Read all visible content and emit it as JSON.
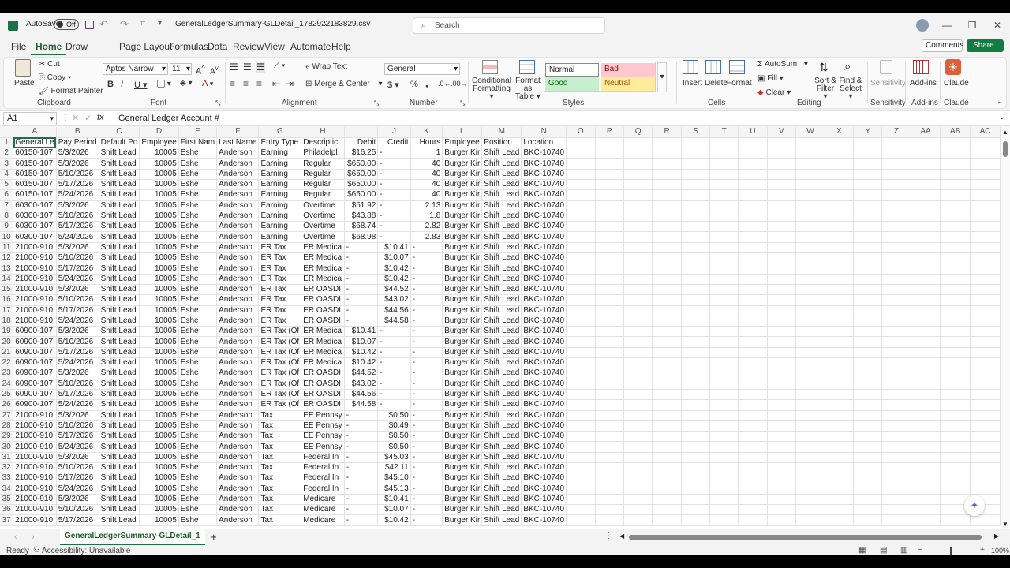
{
  "title": {
    "autosave_label": "AutoSave",
    "autosave_state": "Off",
    "filename": "GeneralLedgerSummary-GLDetail_1782922183829.csv",
    "search_placeholder": "Search"
  },
  "menu": [
    "File",
    "Home",
    "Draw",
    "Page Layout",
    "Formulas",
    "Data",
    "Review",
    "View",
    "Automate",
    "Help"
  ],
  "menu_active": "Home",
  "comments_label": "Comments",
  "share_label": "Share",
  "ribbon": {
    "clipboard": {
      "paste": "Paste",
      "cut": "Cut",
      "copy": "Copy",
      "format_painter": "Format Painter",
      "group": "Clipboard"
    },
    "font": {
      "name": "Aptos Narrow",
      "size": "11",
      "group": "Font"
    },
    "alignment": {
      "wrap": "Wrap Text",
      "merge": "Merge & Center",
      "group": "Alignment"
    },
    "number": {
      "format": "General",
      "group": "Number"
    },
    "styles": {
      "conditional": "Conditional Formatting",
      "format_table": "Format as Table",
      "normal": "Normal",
      "bad": "Bad",
      "good": "Good",
      "neutral": "Neutral",
      "group": "Styles"
    },
    "cells": {
      "insert": "Insert",
      "delete": "Delete",
      "format": "Format",
      "group": "Cells"
    },
    "editing": {
      "autosum": "AutoSum",
      "fill": "Fill",
      "clear": "Clear",
      "sort": "Sort & Filter",
      "find": "Find & Select",
      "group": "Editing"
    },
    "sensitivity": {
      "label": "Sensitivity",
      "group": "Sensitivity"
    },
    "addins": {
      "label": "Add-ins",
      "group": "Add-ins"
    },
    "claude": {
      "label": "Claude",
      "group": "Claude"
    }
  },
  "formula": {
    "cell_ref": "A1",
    "fx": "fx",
    "content": "General Ledger Account #"
  },
  "columns": [
    "A",
    "B",
    "C",
    "D",
    "E",
    "F",
    "G",
    "H",
    "I",
    "J",
    "K",
    "L",
    "M",
    "N",
    "O",
    "P",
    "Q",
    "R",
    "S",
    "T",
    "U",
    "V",
    "W",
    "X",
    "Y",
    "Z",
    "AA",
    "AB",
    "AC"
  ],
  "header_row": [
    "General Le",
    "Pay Period",
    "Default Po",
    "Employee",
    "First Nam",
    "Last Name",
    "Entry Type",
    "Descriptic",
    "Debit",
    "Credit",
    "Hours",
    "Employee",
    "Position",
    "Location"
  ],
  "rows": [
    [
      "60150-107",
      "5/3/2026",
      "Shift Lead",
      "10005",
      "Eshe",
      "Anderson",
      "Earning",
      "Philadelpl",
      "$16.25",
      "-",
      "1",
      "Burger Kir",
      "Shift Lead",
      "BKC-10740"
    ],
    [
      "60150-107",
      "5/3/2026",
      "Shift Lead",
      "10005",
      "Eshe",
      "Anderson",
      "Earning",
      "Regular",
      "$650.00",
      "-",
      "40",
      "Burger Kir",
      "Shift Lead",
      "BKC-10740"
    ],
    [
      "60150-107",
      "5/10/2026",
      "Shift Lead",
      "10005",
      "Eshe",
      "Anderson",
      "Earning",
      "Regular",
      "$650.00",
      "-",
      "40",
      "Burger Kir",
      "Shift Lead",
      "BKC-10740"
    ],
    [
      "60150-107",
      "5/17/2026",
      "Shift Lead",
      "10005",
      "Eshe",
      "Anderson",
      "Earning",
      "Regular",
      "$650.00",
      "-",
      "40",
      "Burger Kir",
      "Shift Lead",
      "BKC-10740"
    ],
    [
      "60150-107",
      "5/24/2026",
      "Shift Lead",
      "10005",
      "Eshe",
      "Anderson",
      "Earning",
      "Regular",
      "$650.00",
      "-",
      "40",
      "Burger Kir",
      "Shift Lead",
      "BKC-10740"
    ],
    [
      "60300-107",
      "5/3/2026",
      "Shift Lead",
      "10005",
      "Eshe",
      "Anderson",
      "Earning",
      "Overtime",
      "$51.92",
      "-",
      "2.13",
      "Burger Kir",
      "Shift Lead",
      "BKC-10740"
    ],
    [
      "60300-107",
      "5/10/2026",
      "Shift Lead",
      "10005",
      "Eshe",
      "Anderson",
      "Earning",
      "Overtime",
      "$43.88",
      "-",
      "1.8",
      "Burger Kir",
      "Shift Lead",
      "BKC-10740"
    ],
    [
      "60300-107",
      "5/17/2026",
      "Shift Lead",
      "10005",
      "Eshe",
      "Anderson",
      "Earning",
      "Overtime",
      "$68.74",
      "-",
      "2.82",
      "Burger Kir",
      "Shift Lead",
      "BKC-10740"
    ],
    [
      "60300-107",
      "5/24/2026",
      "Shift Lead",
      "10005",
      "Eshe",
      "Anderson",
      "Earning",
      "Overtime",
      "$68.98",
      "-",
      "2.83",
      "Burger Kir",
      "Shift Lead",
      "BKC-10740"
    ],
    [
      "21000-910",
      "5/3/2026",
      "Shift Lead",
      "10005",
      "Eshe",
      "Anderson",
      "ER Tax",
      "ER Medica",
      "-",
      "$10.41",
      "-",
      "Burger Kir",
      "Shift Lead",
      "BKC-10740"
    ],
    [
      "21000-910",
      "5/10/2026",
      "Shift Lead",
      "10005",
      "Eshe",
      "Anderson",
      "ER Tax",
      "ER Medica",
      "-",
      "$10.07",
      "-",
      "Burger Kir",
      "Shift Lead",
      "BKC-10740"
    ],
    [
      "21000-910",
      "5/17/2026",
      "Shift Lead",
      "10005",
      "Eshe",
      "Anderson",
      "ER Tax",
      "ER Medica",
      "-",
      "$10.42",
      "-",
      "Burger Kir",
      "Shift Lead",
      "BKC-10740"
    ],
    [
      "21000-910",
      "5/24/2026",
      "Shift Lead",
      "10005",
      "Eshe",
      "Anderson",
      "ER Tax",
      "ER Medica",
      "-",
      "$10.42",
      "-",
      "Burger Kir",
      "Shift Lead",
      "BKC-10740"
    ],
    [
      "21000-910",
      "5/3/2026",
      "Shift Lead",
      "10005",
      "Eshe",
      "Anderson",
      "ER Tax",
      "ER OASDI",
      "-",
      "$44.52",
      "-",
      "Burger Kir",
      "Shift Lead",
      "BKC-10740"
    ],
    [
      "21000-910",
      "5/10/2026",
      "Shift Lead",
      "10005",
      "Eshe",
      "Anderson",
      "ER Tax",
      "ER OASDI",
      "-",
      "$43.02",
      "-",
      "Burger Kir",
      "Shift Lead",
      "BKC-10740"
    ],
    [
      "21000-910",
      "5/17/2026",
      "Shift Lead",
      "10005",
      "Eshe",
      "Anderson",
      "ER Tax",
      "ER OASDI",
      "-",
      "$44.56",
      "-",
      "Burger Kir",
      "Shift Lead",
      "BKC-10740"
    ],
    [
      "21000-910",
      "5/24/2026",
      "Shift Lead",
      "10005",
      "Eshe",
      "Anderson",
      "ER Tax",
      "ER OASDI",
      "-",
      "$44.58",
      "-",
      "Burger Kir",
      "Shift Lead",
      "BKC-10740"
    ],
    [
      "60900-107",
      "5/3/2026",
      "Shift Lead",
      "10005",
      "Eshe",
      "Anderson",
      "ER Tax (Of",
      "ER Medica",
      "$10.41",
      "-",
      "-",
      "Burger Kir",
      "Shift Lead",
      "BKC-10740"
    ],
    [
      "60900-107",
      "5/10/2026",
      "Shift Lead",
      "10005",
      "Eshe",
      "Anderson",
      "ER Tax (Of",
      "ER Medica",
      "$10.07",
      "-",
      "-",
      "Burger Kir",
      "Shift Lead",
      "BKC-10740"
    ],
    [
      "60900-107",
      "5/17/2026",
      "Shift Lead",
      "10005",
      "Eshe",
      "Anderson",
      "ER Tax (Of",
      "ER Medica",
      "$10.42",
      "-",
      "-",
      "Burger Kir",
      "Shift Lead",
      "BKC-10740"
    ],
    [
      "60900-107",
      "5/24/2026",
      "Shift Lead",
      "10005",
      "Eshe",
      "Anderson",
      "ER Tax (Of",
      "ER Medica",
      "$10.42",
      "-",
      "-",
      "Burger Kir",
      "Shift Lead",
      "BKC-10740"
    ],
    [
      "60900-107",
      "5/3/2026",
      "Shift Lead",
      "10005",
      "Eshe",
      "Anderson",
      "ER Tax (Of",
      "ER OASDI",
      "$44.52",
      "-",
      "-",
      "Burger Kir",
      "Shift Lead",
      "BKC-10740"
    ],
    [
      "60900-107",
      "5/10/2026",
      "Shift Lead",
      "10005",
      "Eshe",
      "Anderson",
      "ER Tax (Of",
      "ER OASDI",
      "$43.02",
      "-",
      "-",
      "Burger Kir",
      "Shift Lead",
      "BKC-10740"
    ],
    [
      "60900-107",
      "5/17/2026",
      "Shift Lead",
      "10005",
      "Eshe",
      "Anderson",
      "ER Tax (Of",
      "ER OASDI",
      "$44.56",
      "-",
      "-",
      "Burger Kir",
      "Shift Lead",
      "BKC-10740"
    ],
    [
      "60900-107",
      "5/24/2026",
      "Shift Lead",
      "10005",
      "Eshe",
      "Anderson",
      "ER Tax (Of",
      "ER OASDI",
      "$44.58",
      "-",
      "-",
      "Burger Kir",
      "Shift Lead",
      "BKC-10740"
    ],
    [
      "21000-910",
      "5/3/2026",
      "Shift Lead",
      "10005",
      "Eshe",
      "Anderson",
      "Tax",
      "EE Pennsy",
      "-",
      "$0.50",
      "-",
      "Burger Kir",
      "Shift Lead",
      "BKC-10740"
    ],
    [
      "21000-910",
      "5/10/2026",
      "Shift Lead",
      "10005",
      "Eshe",
      "Anderson",
      "Tax",
      "EE Pennsy",
      "-",
      "$0.49",
      "-",
      "Burger Kir",
      "Shift Lead",
      "BKC-10740"
    ],
    [
      "21000-910",
      "5/17/2026",
      "Shift Lead",
      "10005",
      "Eshe",
      "Anderson",
      "Tax",
      "EE Pennsy",
      "-",
      "$0.50",
      "-",
      "Burger Kir",
      "Shift Lead",
      "BKC-10740"
    ],
    [
      "21000-910",
      "5/24/2026",
      "Shift Lead",
      "10005",
      "Eshe",
      "Anderson",
      "Tax",
      "EE Pennsy",
      "-",
      "$0.50",
      "-",
      "Burger Kir",
      "Shift Lead",
      "BKC-10740"
    ],
    [
      "21000-910",
      "5/3/2026",
      "Shift Lead",
      "10005",
      "Eshe",
      "Anderson",
      "Tax",
      "Federal In",
      "-",
      "$45.03",
      "-",
      "Burger Kir",
      "Shift Lead",
      "BKC-10740"
    ],
    [
      "21000-910",
      "5/10/2026",
      "Shift Lead",
      "10005",
      "Eshe",
      "Anderson",
      "Tax",
      "Federal In",
      "-",
      "$42.11",
      "-",
      "Burger Kir",
      "Shift Lead",
      "BKC-10740"
    ],
    [
      "21000-910",
      "5/17/2026",
      "Shift Lead",
      "10005",
      "Eshe",
      "Anderson",
      "Tax",
      "Federal In",
      "-",
      "$45.10",
      "-",
      "Burger Kir",
      "Shift Lead",
      "BKC-10740"
    ],
    [
      "21000-910",
      "5/24/2026",
      "Shift Lead",
      "10005",
      "Eshe",
      "Anderson",
      "Tax",
      "Federal In",
      "-",
      "$45.13",
      "-",
      "Burger Kir",
      "Shift Lead",
      "BKC-10740"
    ],
    [
      "21000-910",
      "5/3/2026",
      "Shift Lead",
      "10005",
      "Eshe",
      "Anderson",
      "Tax",
      "Medicare",
      "-",
      "$10.41",
      "-",
      "Burger Kir",
      "Shift Lead",
      "BKC-10740"
    ],
    [
      "21000-910",
      "5/10/2026",
      "Shift Lead",
      "10005",
      "Eshe",
      "Anderson",
      "Tax",
      "Medicare",
      "-",
      "$10.07",
      "-",
      "Burger Kir",
      "Shift Lead",
      "BKC-10740"
    ],
    [
      "21000-910",
      "5/17/2026",
      "Shift Lead",
      "10005",
      "Eshe",
      "Anderson",
      "Tax",
      "Medicare",
      "-",
      "$10.42",
      "-",
      "Burger Kir",
      "Shift Lead",
      "BKC-10740"
    ]
  ],
  "sheet_tab": "GeneralLedgerSummary-GLDetail_1",
  "status": {
    "ready": "Ready",
    "accessibility": "Accessibility: Unavailable",
    "zoom": "100%"
  },
  "colors": {
    "excel_green": "#1e7145",
    "share_green": "#107c41",
    "bad_bg": "#ffc7ce",
    "good_bg": "#c6efce",
    "neutral_bg": "#ffeb9c"
  }
}
